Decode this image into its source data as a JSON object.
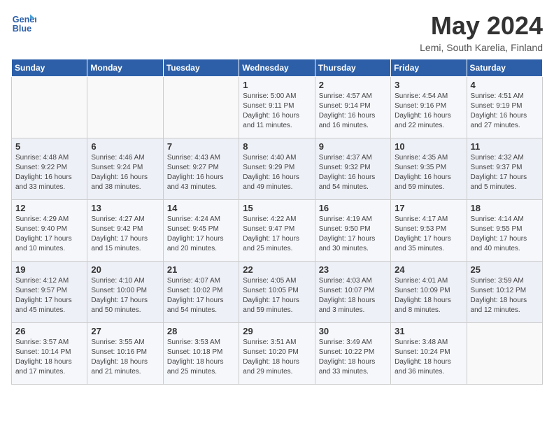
{
  "header": {
    "logo_line1": "General",
    "logo_line2": "Blue",
    "month": "May 2024",
    "location": "Lemi, South Karelia, Finland"
  },
  "weekdays": [
    "Sunday",
    "Monday",
    "Tuesday",
    "Wednesday",
    "Thursday",
    "Friday",
    "Saturday"
  ],
  "weeks": [
    [
      {
        "day": "",
        "info": ""
      },
      {
        "day": "",
        "info": ""
      },
      {
        "day": "",
        "info": ""
      },
      {
        "day": "1",
        "info": "Sunrise: 5:00 AM\nSunset: 9:11 PM\nDaylight: 16 hours\nand 11 minutes."
      },
      {
        "day": "2",
        "info": "Sunrise: 4:57 AM\nSunset: 9:14 PM\nDaylight: 16 hours\nand 16 minutes."
      },
      {
        "day": "3",
        "info": "Sunrise: 4:54 AM\nSunset: 9:16 PM\nDaylight: 16 hours\nand 22 minutes."
      },
      {
        "day": "4",
        "info": "Sunrise: 4:51 AM\nSunset: 9:19 PM\nDaylight: 16 hours\nand 27 minutes."
      }
    ],
    [
      {
        "day": "5",
        "info": "Sunrise: 4:48 AM\nSunset: 9:22 PM\nDaylight: 16 hours\nand 33 minutes."
      },
      {
        "day": "6",
        "info": "Sunrise: 4:46 AM\nSunset: 9:24 PM\nDaylight: 16 hours\nand 38 minutes."
      },
      {
        "day": "7",
        "info": "Sunrise: 4:43 AM\nSunset: 9:27 PM\nDaylight: 16 hours\nand 43 minutes."
      },
      {
        "day": "8",
        "info": "Sunrise: 4:40 AM\nSunset: 9:29 PM\nDaylight: 16 hours\nand 49 minutes."
      },
      {
        "day": "9",
        "info": "Sunrise: 4:37 AM\nSunset: 9:32 PM\nDaylight: 16 hours\nand 54 minutes."
      },
      {
        "day": "10",
        "info": "Sunrise: 4:35 AM\nSunset: 9:35 PM\nDaylight: 16 hours\nand 59 minutes."
      },
      {
        "day": "11",
        "info": "Sunrise: 4:32 AM\nSunset: 9:37 PM\nDaylight: 17 hours\nand 5 minutes."
      }
    ],
    [
      {
        "day": "12",
        "info": "Sunrise: 4:29 AM\nSunset: 9:40 PM\nDaylight: 17 hours\nand 10 minutes."
      },
      {
        "day": "13",
        "info": "Sunrise: 4:27 AM\nSunset: 9:42 PM\nDaylight: 17 hours\nand 15 minutes."
      },
      {
        "day": "14",
        "info": "Sunrise: 4:24 AM\nSunset: 9:45 PM\nDaylight: 17 hours\nand 20 minutes."
      },
      {
        "day": "15",
        "info": "Sunrise: 4:22 AM\nSunset: 9:47 PM\nDaylight: 17 hours\nand 25 minutes."
      },
      {
        "day": "16",
        "info": "Sunrise: 4:19 AM\nSunset: 9:50 PM\nDaylight: 17 hours\nand 30 minutes."
      },
      {
        "day": "17",
        "info": "Sunrise: 4:17 AM\nSunset: 9:53 PM\nDaylight: 17 hours\nand 35 minutes."
      },
      {
        "day": "18",
        "info": "Sunrise: 4:14 AM\nSunset: 9:55 PM\nDaylight: 17 hours\nand 40 minutes."
      }
    ],
    [
      {
        "day": "19",
        "info": "Sunrise: 4:12 AM\nSunset: 9:57 PM\nDaylight: 17 hours\nand 45 minutes."
      },
      {
        "day": "20",
        "info": "Sunrise: 4:10 AM\nSunset: 10:00 PM\nDaylight: 17 hours\nand 50 minutes."
      },
      {
        "day": "21",
        "info": "Sunrise: 4:07 AM\nSunset: 10:02 PM\nDaylight: 17 hours\nand 54 minutes."
      },
      {
        "day": "22",
        "info": "Sunrise: 4:05 AM\nSunset: 10:05 PM\nDaylight: 17 hours\nand 59 minutes."
      },
      {
        "day": "23",
        "info": "Sunrise: 4:03 AM\nSunset: 10:07 PM\nDaylight: 18 hours\nand 3 minutes."
      },
      {
        "day": "24",
        "info": "Sunrise: 4:01 AM\nSunset: 10:09 PM\nDaylight: 18 hours\nand 8 minutes."
      },
      {
        "day": "25",
        "info": "Sunrise: 3:59 AM\nSunset: 10:12 PM\nDaylight: 18 hours\nand 12 minutes."
      }
    ],
    [
      {
        "day": "26",
        "info": "Sunrise: 3:57 AM\nSunset: 10:14 PM\nDaylight: 18 hours\nand 17 minutes."
      },
      {
        "day": "27",
        "info": "Sunrise: 3:55 AM\nSunset: 10:16 PM\nDaylight: 18 hours\nand 21 minutes."
      },
      {
        "day": "28",
        "info": "Sunrise: 3:53 AM\nSunset: 10:18 PM\nDaylight: 18 hours\nand 25 minutes."
      },
      {
        "day": "29",
        "info": "Sunrise: 3:51 AM\nSunset: 10:20 PM\nDaylight: 18 hours\nand 29 minutes."
      },
      {
        "day": "30",
        "info": "Sunrise: 3:49 AM\nSunset: 10:22 PM\nDaylight: 18 hours\nand 33 minutes."
      },
      {
        "day": "31",
        "info": "Sunrise: 3:48 AM\nSunset: 10:24 PM\nDaylight: 18 hours\nand 36 minutes."
      },
      {
        "day": "",
        "info": ""
      }
    ]
  ]
}
